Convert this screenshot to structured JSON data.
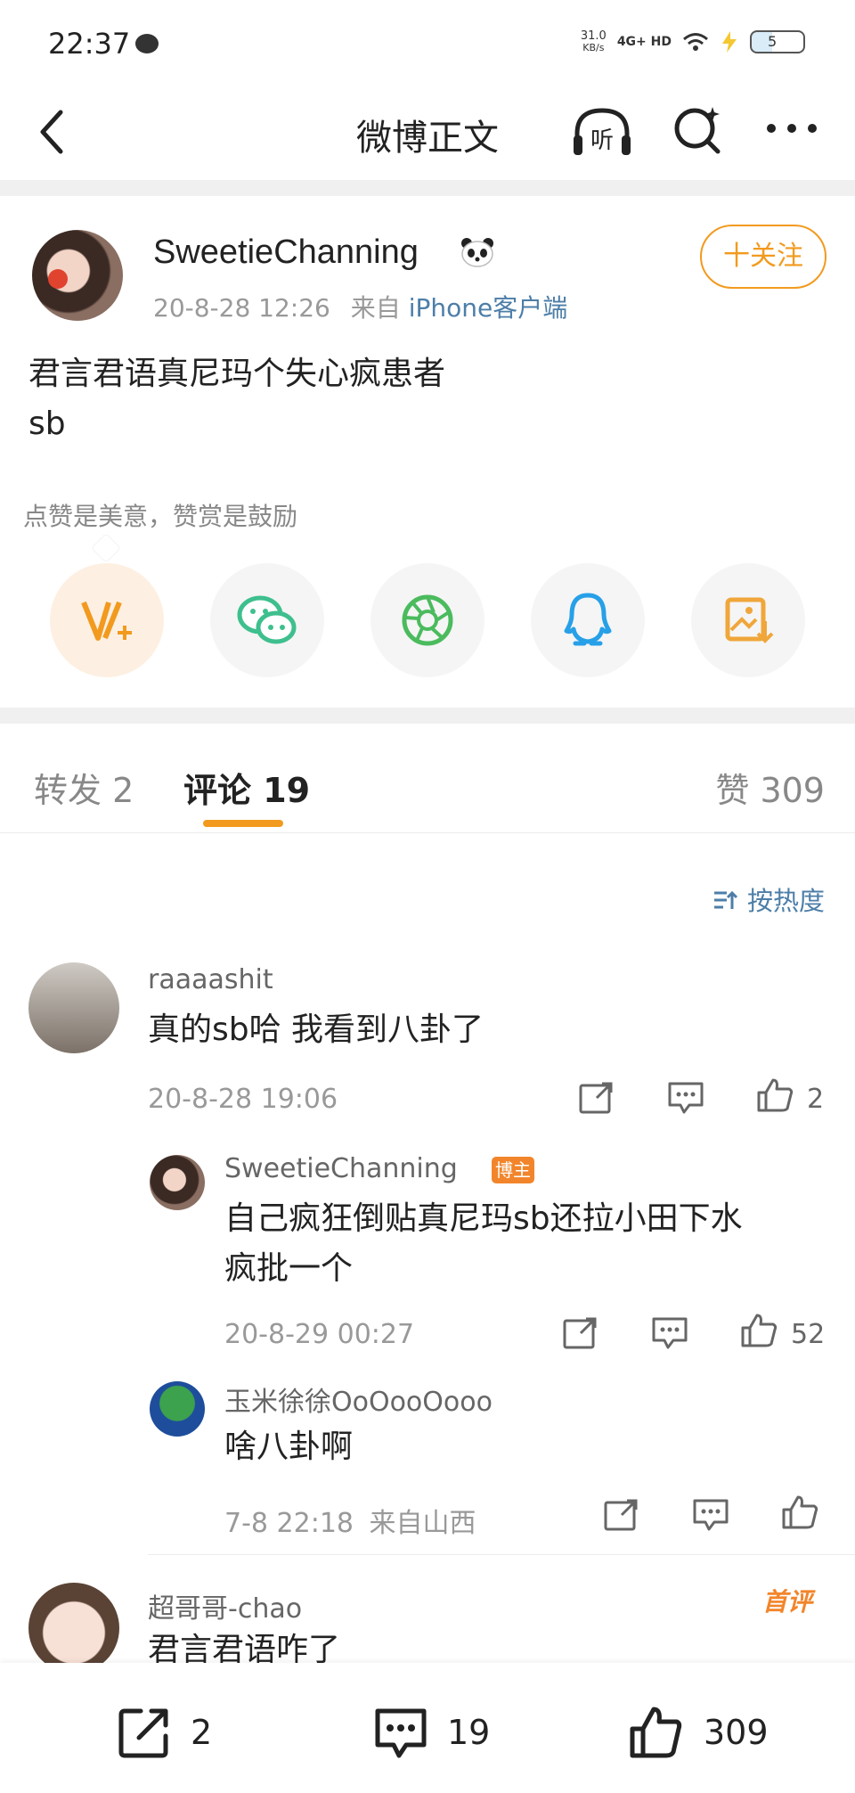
{
  "status_bar": {
    "time": "22:37",
    "net_speed_value": "31.0",
    "net_speed_unit": "KB/s",
    "network": "4G+ HD",
    "battery": "5"
  },
  "nav": {
    "title": "微博正文",
    "listen_label": "听"
  },
  "post": {
    "author": "SweetieChanning",
    "date": "20-8-28 12:26",
    "source_prefix": "来自",
    "source_client": "iPhone客户端",
    "follow_label": "十关注",
    "text_lines": [
      "君言君语真尼玛个失心疯患者",
      "sb"
    ]
  },
  "share": {
    "hint": "点赞是美意，赞赏是鼓励",
    "items": [
      "reward",
      "wechat",
      "moments",
      "qq",
      "save-image"
    ]
  },
  "tabs": {
    "repost": "转发 2",
    "comments": "评论 19",
    "likes": "赞 309"
  },
  "sort_label": "按热度",
  "comments": [
    {
      "name": "raaaashit",
      "text": "真的sb哈 我看到八卦了",
      "time": "20-8-28 19:06",
      "likes": "2"
    },
    {
      "name": "SweetieChanning",
      "badge": "博主",
      "text_lines": [
        "自己疯狂倒贴真尼玛sb还拉小田下水",
        "疯批一个"
      ],
      "time": "20-8-29 00:27",
      "likes": "52"
    },
    {
      "name": "玉米徐徐OoOooOooo",
      "text": "啥八卦啊",
      "time": "7-8 22:18",
      "location": "来自山西"
    },
    {
      "name": "超哥哥-chao",
      "badge": "首评",
      "text": "君言君语咋了"
    }
  ],
  "bottom_bar": {
    "repost_count": "2",
    "comment_count": "19",
    "like_count": "309"
  },
  "colors": {
    "accent": "#f29a1e",
    "link": "#4d7ea8",
    "wechat": "#3ebf8e",
    "moments": "#4bbb5e",
    "qq": "#27a0e8",
    "save": "#f0a63a"
  }
}
